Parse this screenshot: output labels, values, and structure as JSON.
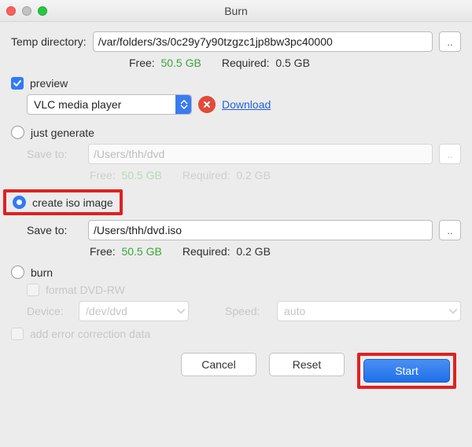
{
  "window": {
    "title": "Burn"
  },
  "temp": {
    "label": "Temp directory:",
    "path": "/var/folders/3s/0c29y7y90tzgzc1jp8bw3pc40000",
    "browse": "..",
    "free_label": "Free:",
    "free_value": "50.5 GB",
    "required_label": "Required:",
    "required_value": "0.5 GB"
  },
  "preview": {
    "checked": true,
    "label": "preview",
    "player": "VLC media player",
    "download": "Download"
  },
  "just_generate": {
    "selected": false,
    "label": "just generate",
    "saveto_label": "Save to:",
    "path": "/Users/thh/dvd",
    "browse": "..",
    "free_label": "Free:",
    "free_value": "50.5 GB",
    "required_label": "Required:",
    "required_value": "0.2 GB"
  },
  "create_iso": {
    "selected": true,
    "label": "create iso image",
    "saveto_label": "Save to:",
    "path": "/Users/thh/dvd.iso",
    "browse": "..",
    "free_label": "Free:",
    "free_value": "50.5 GB",
    "required_label": "Required:",
    "required_value": "0.2 GB"
  },
  "burn": {
    "selected": false,
    "label": "burn",
    "format_label": "format DVD-RW",
    "device_label": "Device:",
    "device_value": "/dev/dvd",
    "speed_label": "Speed:",
    "speed_value": "auto"
  },
  "ecc": {
    "checked": false,
    "label": "add error correction data"
  },
  "footer": {
    "cancel": "Cancel",
    "reset": "Reset",
    "start": "Start"
  }
}
